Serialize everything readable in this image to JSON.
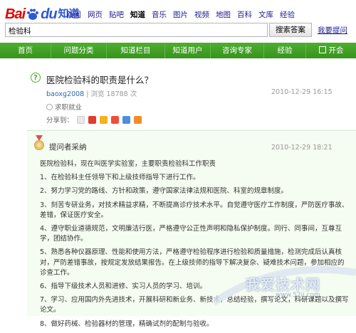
{
  "logo": {
    "part1": "Bai",
    "part2": "du",
    "product": "知道"
  },
  "nav_links": [
    "新闻",
    "网页",
    "贴吧",
    "知道",
    "音乐",
    "图片",
    "视频",
    "地图",
    "百科",
    "文库",
    "经验"
  ],
  "nav_active": "知道",
  "search": {
    "value": "检验科",
    "button": "搜索答案",
    "ask_link": "我要提问"
  },
  "green_nav": [
    "首页",
    "问题分类",
    "知道栏目",
    "知道用户",
    "咨询专家",
    "经验",
    "开会"
  ],
  "question": {
    "title": "医院检验科的职责是什么？",
    "user": "baoxg2008",
    "views": "浏览 18788 次",
    "time": "2010-12-29 16:15",
    "tag": "求职就业",
    "share_label": "分享到："
  },
  "answer": {
    "label": "提问者采纳",
    "time": "2010-12-29 18:21",
    "paragraphs": [
      "医院检验科，现在叫医学实验室，主要职责检验科工作职责",
      "1、在检验科主任领导下和上级技师指导下进行工作。",
      "2、努力学习党的路线、方针和政策，遵守国家法律法规和医院、科室的规章制度。",
      "3、刻苦专研业务，对技术精益求精，不断提高诊疗技术水平。自觉遵守医疗工作制度，严防医疗事故、差错，保证医疗安全。",
      "4、遵守职业道德规范，文明廉洁行医，严格遵守公正性声明和隐私保护制度。同行、同事间，互尊互学，团结协作。",
      "5、熟悉各种仪器原理、性能和使用方法，严格遵守检验程序进行检验和质量措施，检测完成后认真核对，严防差错事故，按规定发放结果报告。在上级技师的指导下解决复杂、疑难技术问题，参加相应的诊查工作。",
      "6、指导下级技术人员和进修、实习人员的学习、培训。",
      "7、学习、应用国内外先进技术，开展科研和新业务、新技术，总结经验，撰写论文，科研课题以及撰写论文。",
      "8、做好药械、检验器材的管理，精确试剂的配制与验收。"
    ]
  },
  "watermark": {
    "text": "我爱技术网",
    "url": "www.52ij.com"
  },
  "colors": {
    "brand_red": "#e10602",
    "brand_blue": "#2c5ad7",
    "nav_green": "#3f9f25",
    "answer_bg": "#f5fcf1"
  }
}
